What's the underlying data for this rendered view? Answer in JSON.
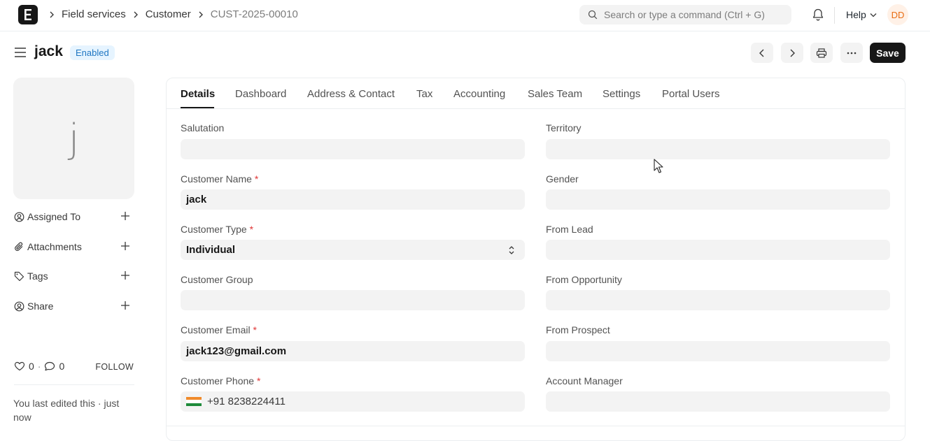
{
  "breadcrumbs": [
    "Field services",
    "Customer",
    "CUST-2025-00010"
  ],
  "search": {
    "placeholder": "Search or type a command (Ctrl + G)"
  },
  "nav": {
    "help_label": "Help",
    "avatar_initials": "DD"
  },
  "page": {
    "title": "jack",
    "status_badge": "Enabled",
    "save_label": "Save"
  },
  "sidebar": {
    "avatar_letter": "j",
    "items": [
      {
        "label": "Assigned To",
        "icon": "assign-icon"
      },
      {
        "label": "Attachments",
        "icon": "paperclip-icon"
      },
      {
        "label": "Tags",
        "icon": "tag-icon"
      },
      {
        "label": "Share",
        "icon": "share-icon"
      }
    ],
    "likes": "0",
    "comments": "0",
    "follow_label": "FOLLOW",
    "last_edited": "You last edited this · just now"
  },
  "tabs": [
    "Details",
    "Dashboard",
    "Address & Contact",
    "Tax",
    "Accounting",
    "Sales Team",
    "Settings",
    "Portal Users"
  ],
  "form": {
    "left": [
      {
        "label": "Salutation",
        "required": false,
        "value": ""
      },
      {
        "label": "Customer Name",
        "required": true,
        "value": "jack"
      },
      {
        "label": "Customer Type",
        "required": true,
        "value": "Individual"
      },
      {
        "label": "Customer Group",
        "required": false,
        "value": ""
      },
      {
        "label": "Customer Email",
        "required": true,
        "value": "jack123@gmail.com"
      },
      {
        "label": "Customer Phone",
        "required": true,
        "value": "+91 8238224411"
      }
    ],
    "right": [
      {
        "label": "Territory",
        "value": ""
      },
      {
        "label": "Gender",
        "value": ""
      },
      {
        "label": "From Lead",
        "value": ""
      },
      {
        "label": "From Opportunity",
        "value": ""
      },
      {
        "label": "From Prospect",
        "value": ""
      },
      {
        "label": "Account Manager",
        "value": ""
      }
    ],
    "required_marker": "*"
  },
  "colors": {
    "primary": "#171717",
    "badge_bg": "#e6f4ff",
    "badge_text": "#1f76c2",
    "required": "#e03636",
    "field_bg": "#f3f3f3"
  }
}
